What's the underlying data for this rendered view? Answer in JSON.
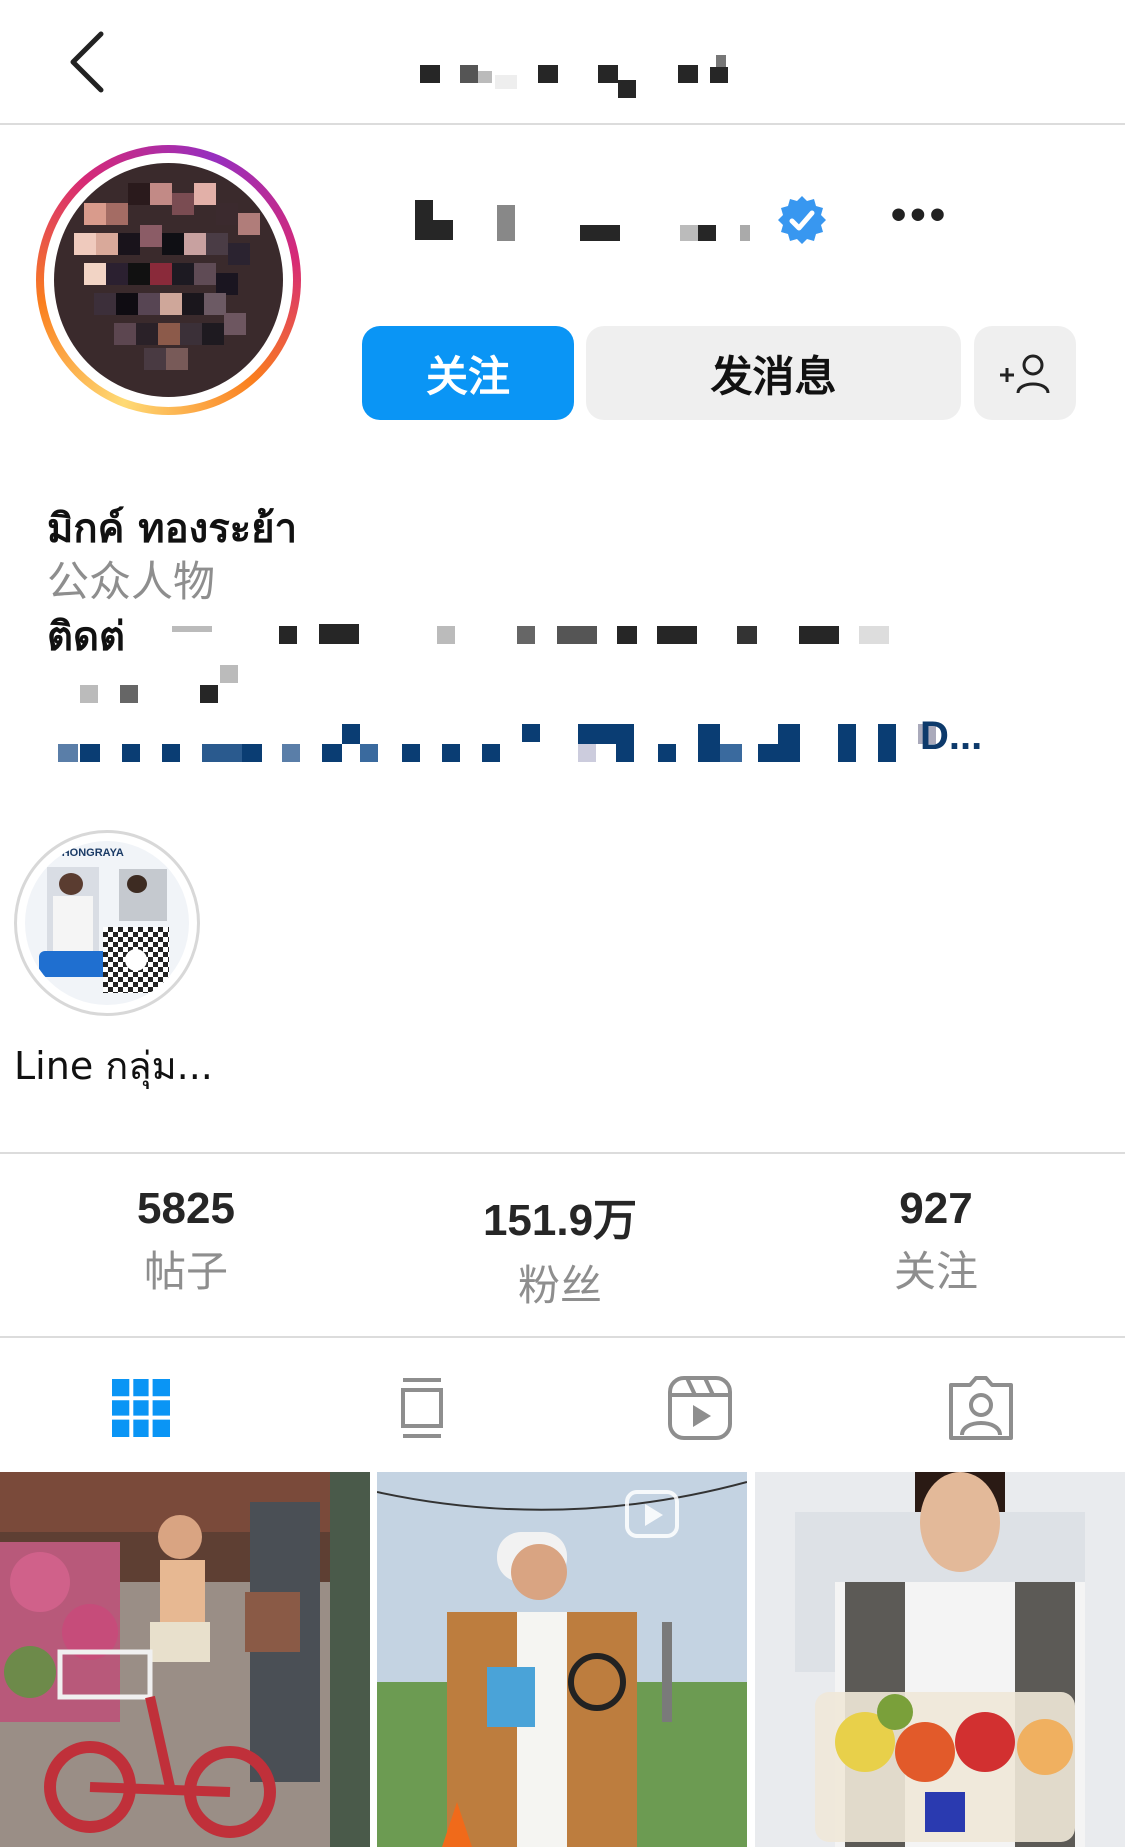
{
  "header": {
    "back_icon": "chevron-left-icon",
    "more_label": "•••"
  },
  "profile": {
    "display_name": "มิกค์ ทองระย้า",
    "category": "公众人物",
    "contact_prefix": "ติดต่",
    "link_tail": "D...",
    "verified": true,
    "verified_color": "#3897f0",
    "ring_colors": [
      "#feda75",
      "#fa7e1e",
      "#d62976",
      "#962fbf"
    ]
  },
  "actions": {
    "follow_label": "关注",
    "message_label": "发消息",
    "add_friend_icon": "add-person-icon",
    "follow_color": "#0a95f5"
  },
  "highlights": [
    {
      "label": "Line กลุ่ม...",
      "badge": "THONGRAYA"
    }
  ],
  "stats": [
    {
      "value": "5825",
      "label": "帖子"
    },
    {
      "value": "151.9万",
      "label": "粉丝"
    },
    {
      "value": "927",
      "label": "关注"
    }
  ],
  "tabs": [
    {
      "icon": "grid-icon",
      "active": true
    },
    {
      "icon": "guide-icon",
      "active": false
    },
    {
      "icon": "reels-icon",
      "active": false
    },
    {
      "icon": "tagged-icon",
      "active": false
    }
  ],
  "posts": [
    {
      "type": "photo"
    },
    {
      "type": "reel"
    },
    {
      "type": "photo"
    }
  ]
}
